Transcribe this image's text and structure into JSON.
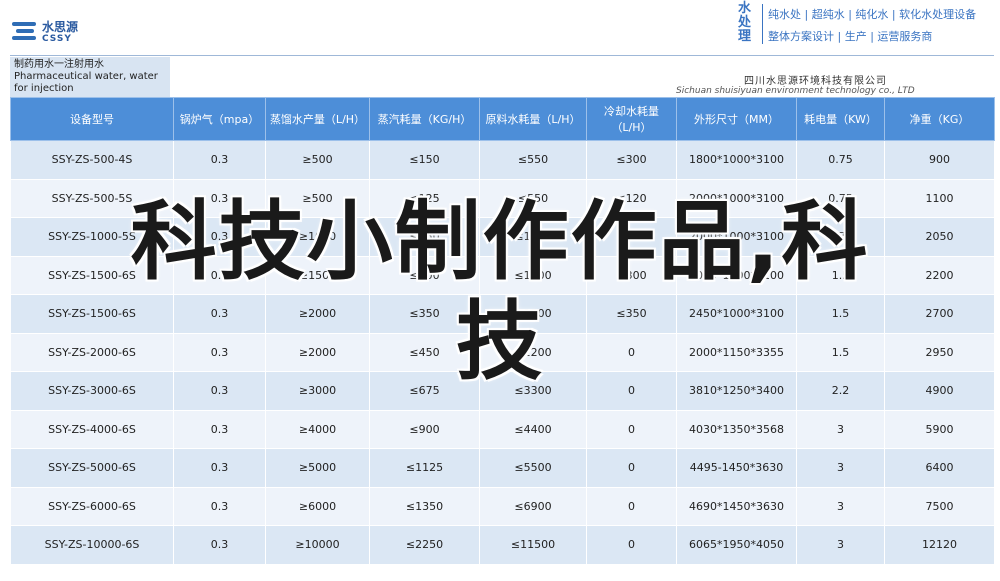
{
  "header": {
    "logo_cn": "水思源",
    "logo_en": "CSSY",
    "brand_vertical": "水处理",
    "brand_line1": "纯水处 | 超纯水 | 纯化水 | 软化水处理设备",
    "brand_line2": "整体方案设计 | 生产 | 运营服务商",
    "title_line1": "制药用水一注射用水",
    "title_line2": "Pharmaceutical water, water for injection",
    "company_cn": "四川水思源环境科技有限公司",
    "company_en": "Sichuan shuisiyuan environment technology co., LTD"
  },
  "table": {
    "columns": [
      "设备型号",
      "锅炉气（mpa）",
      "蒸馏水产量（L/H）",
      "蒸汽耗量（KG/H）",
      "原料水耗量（L/H）",
      "冷却水耗量（L/H）",
      "外形尺寸（MM）",
      "耗电量（KW）",
      "净重（KG）"
    ],
    "rows": [
      [
        "SSY-ZS-500-4S",
        "0.3",
        "≥500",
        "≤150",
        "≤550",
        "≤300",
        "1800*1000*3100",
        "0.75",
        "900"
      ],
      [
        "SSY-ZS-500-5S",
        "0.3",
        "≥500",
        "≤125",
        "≤550",
        "≤120",
        "2000*1000*3100",
        "0.75",
        "1100"
      ],
      [
        "SSY-ZS-1000-5S",
        "0.3",
        "≥1000",
        "≤250",
        "≤1100",
        "≤240",
        "2000*1000*3100",
        "0.75",
        "2050"
      ],
      [
        "SSY-ZS-1500-6S",
        "0.3",
        "≥1500",
        "≤300",
        "≤1600",
        "≤300",
        "2000*1000*3100",
        "1.5",
        "2200"
      ],
      [
        "SSY-ZS-1500-6S",
        "0.3",
        "≥2000",
        "≤350",
        "≤2200",
        "≤350",
        "2450*1000*3100",
        "1.5",
        "2700"
      ],
      [
        "SSY-ZS-2000-6S",
        "0.3",
        "≥2000",
        "≤450",
        "≤2200",
        "0",
        "2000*1150*3355",
        "1.5",
        "2950"
      ],
      [
        "SSY-ZS-3000-6S",
        "0.3",
        "≥3000",
        "≤675",
        "≤3300",
        "0",
        "3810*1250*3400",
        "2.2",
        "4900"
      ],
      [
        "SSY-ZS-4000-6S",
        "0.3",
        "≥4000",
        "≤900",
        "≤4400",
        "0",
        "4030*1350*3568",
        "3",
        "5900"
      ],
      [
        "SSY-ZS-5000-6S",
        "0.3",
        "≥5000",
        "≤1125",
        "≤5500",
        "0",
        "4495-1450*3630",
        "3",
        "6400"
      ],
      [
        "SSY-ZS-6000-6S",
        "0.3",
        "≥6000",
        "≤1350",
        "≤6900",
        "0",
        "4690*1450*3630",
        "3",
        "7500"
      ],
      [
        "SSY-ZS-10000-6S",
        "0.3",
        "≥10000",
        "≤2250",
        "≤11500",
        "0",
        "6065*1950*4050",
        "3",
        "12120"
      ]
    ]
  },
  "watermark": {
    "line1": "科技小制作作品,科",
    "line2": "技"
  }
}
